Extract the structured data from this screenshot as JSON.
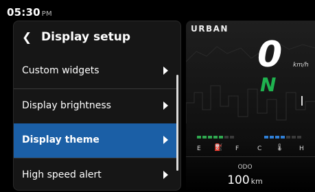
{
  "status": {
    "time": "05:30",
    "ampm": "PM"
  },
  "menu": {
    "title": "Display setup",
    "items": [
      {
        "label": "Custom widgets",
        "selected": false
      },
      {
        "label": "Display brightness",
        "selected": false
      },
      {
        "label": "Display theme",
        "selected": true
      },
      {
        "label": "High speed alert",
        "selected": false
      }
    ]
  },
  "dashboard": {
    "mode": "URBAN",
    "speed": "0",
    "speed_unit": "km/h",
    "gear": "N",
    "fuel": {
      "empty_label": "E",
      "full_label": "F",
      "icon": "fuel-pump-icon",
      "level_segments": 5,
      "total_segments": 7,
      "color": "#2fa84f"
    },
    "temperature": {
      "cold_label": "C",
      "hot_label": "H",
      "icon": "thermometer-icon",
      "level_segments": 4,
      "total_segments": 7,
      "color": "#2f7fd6"
    },
    "odometer": {
      "label": "ODO",
      "value": "100",
      "unit": "km"
    }
  },
  "colors": {
    "accent": "#1b5fa6",
    "gear_green": "#1fb24f",
    "background": "#000000"
  }
}
